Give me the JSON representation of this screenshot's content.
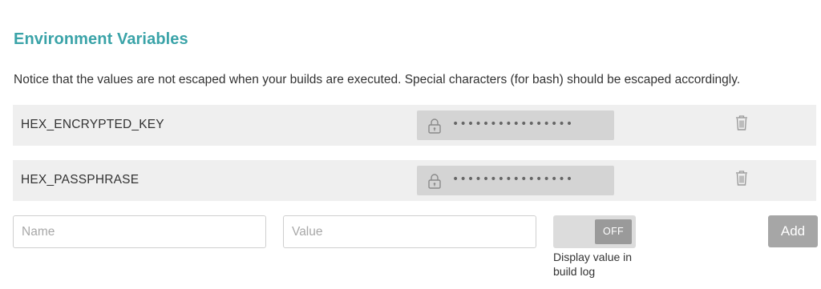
{
  "section": {
    "title": "Environment Variables",
    "notice": "Notice that the values are not escaped when your builds are executed. Special characters (for bash) should be escaped accordingly."
  },
  "variables": [
    {
      "name": "HEX_ENCRYPTED_KEY",
      "value_masked": "••••••••••••••••",
      "icon": "lock-icon",
      "delete_icon": "trash-icon"
    },
    {
      "name": "HEX_PASSPHRASE",
      "value_masked": "••••••••••••••••",
      "icon": "lock-icon",
      "delete_icon": "trash-icon"
    }
  ],
  "new_variable": {
    "name_placeholder": "Name",
    "value_placeholder": "Value",
    "toggle_state": "OFF",
    "toggle_caption": "Display value in build log",
    "add_label": "Add"
  },
  "colors": {
    "title": "#3aa3a8",
    "row_background": "#efefef",
    "secret_background": "#d4d4d4",
    "toggle_knob": "#9a9a9a",
    "add_button": "#a6a6a6"
  }
}
